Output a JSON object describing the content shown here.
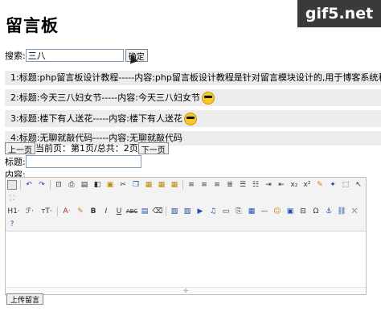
{
  "page": {
    "title": "留言板",
    "watermark": "gif5.net"
  },
  "search": {
    "label": "搜索:",
    "value": "三八",
    "button": "确定"
  },
  "messages": [
    {
      "text": "1:标题:php留言板设计教程-----内容:php留言板设计教程是针对留言模块设计的,用于博客系统和",
      "emoji": false
    },
    {
      "text": "2:标题:今天三八妇女节-----内容:今天三八妇女节",
      "emoji": true
    },
    {
      "text": "3:标题:楼下有人送花-----内容:楼下有人送花",
      "emoji": true
    },
    {
      "text": "4:标题:无聊就敲代码-----内容:无聊就敲代码",
      "emoji": false
    }
  ],
  "pager": {
    "prev": "上一页",
    "status": "当前页：第1页/总共：2页",
    "next": "下一页"
  },
  "form": {
    "title_label": "标题:",
    "content_label": "内容:",
    "submit": "上传留言"
  },
  "editor": {
    "row2_labels": [
      "H1·",
      "ℱ·",
      "ᴛT·",
      "A·"
    ]
  }
}
